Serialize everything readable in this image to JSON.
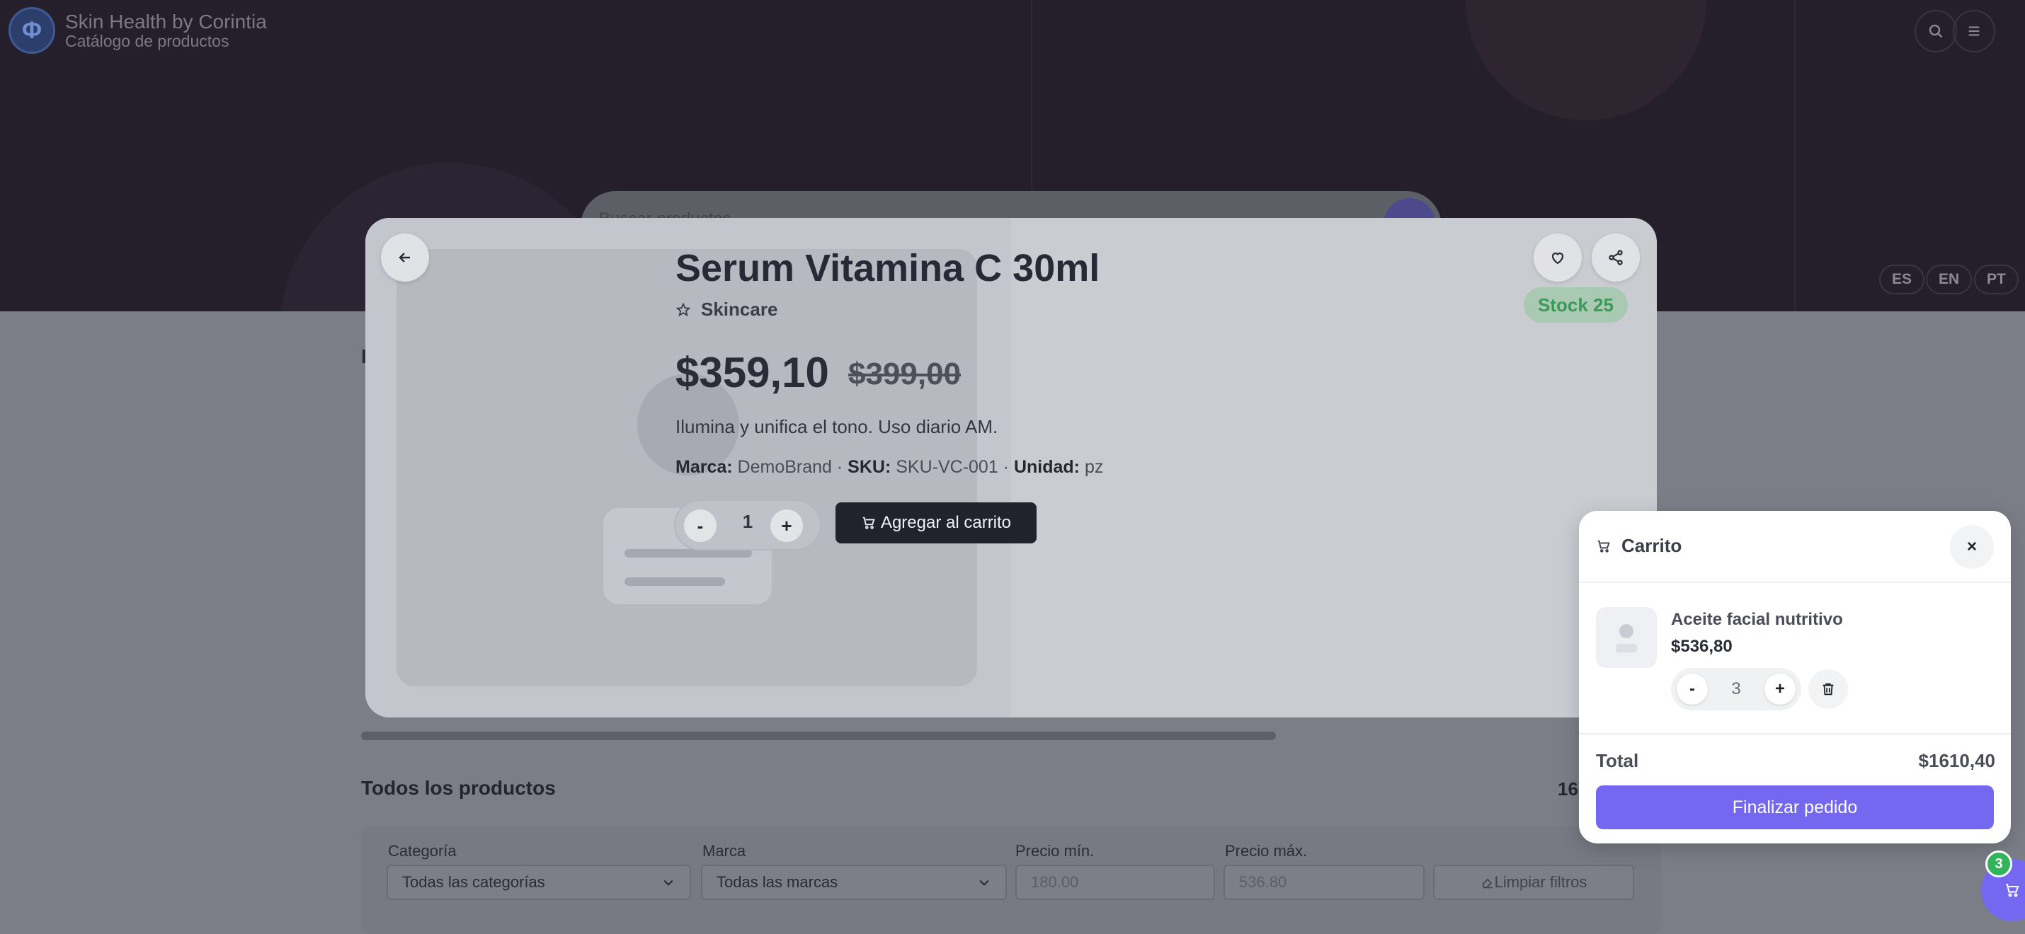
{
  "app": {
    "brand_title": "Skin Health by Corintia",
    "brand_subtitle": "Catálogo de productos",
    "search_placeholder": "Buscar productos...",
    "languages": [
      "ES",
      "EN",
      "PT"
    ]
  },
  "catalog": {
    "section_title": "Todos los productos",
    "product_count": "16",
    "filters": {
      "category_label": "Categoría",
      "category_value": "Todas las categorías",
      "brand_label": "Marca",
      "brand_value": "Todas las marcas",
      "min_price_label": "Precio mín.",
      "min_price_placeholder": "180.00",
      "max_price_label": "Precio máx.",
      "max_price_placeholder": "536.80",
      "clear_label": "Limpiar filtros"
    }
  },
  "product": {
    "title": "Serum Vitamina C 30ml",
    "category": "Skincare",
    "stock": "Stock 25",
    "price": "$359,10",
    "old_price": "$399,00",
    "description": "Ilumina y unifica el tono. Uso diario AM.",
    "brand_key": "Marca:",
    "brand_value": "DemoBrand",
    "sku_key": "SKU:",
    "sku_value": "SKU-VC-001",
    "unit_key": "Unidad:",
    "unit_value": "pz",
    "separator": " · ",
    "quantity": "1",
    "minus": "-",
    "plus": "+",
    "add_to_cart": "Agregar al carrito"
  },
  "cart": {
    "title": "Carrito",
    "close": "×",
    "item": {
      "name": "Aceite facial nutritivo",
      "price": "$536,80",
      "quantity": "3",
      "minus": "-",
      "plus": "+"
    },
    "total_label": "Total",
    "total_value": "$1610,40",
    "checkout": "Finalizar pedido",
    "badge_count": "3"
  },
  "colors": {
    "accent": "#7568f0",
    "stock_green": "#3b9a5a",
    "badge_green": "#31b45b",
    "dark_button": "#21222c"
  }
}
